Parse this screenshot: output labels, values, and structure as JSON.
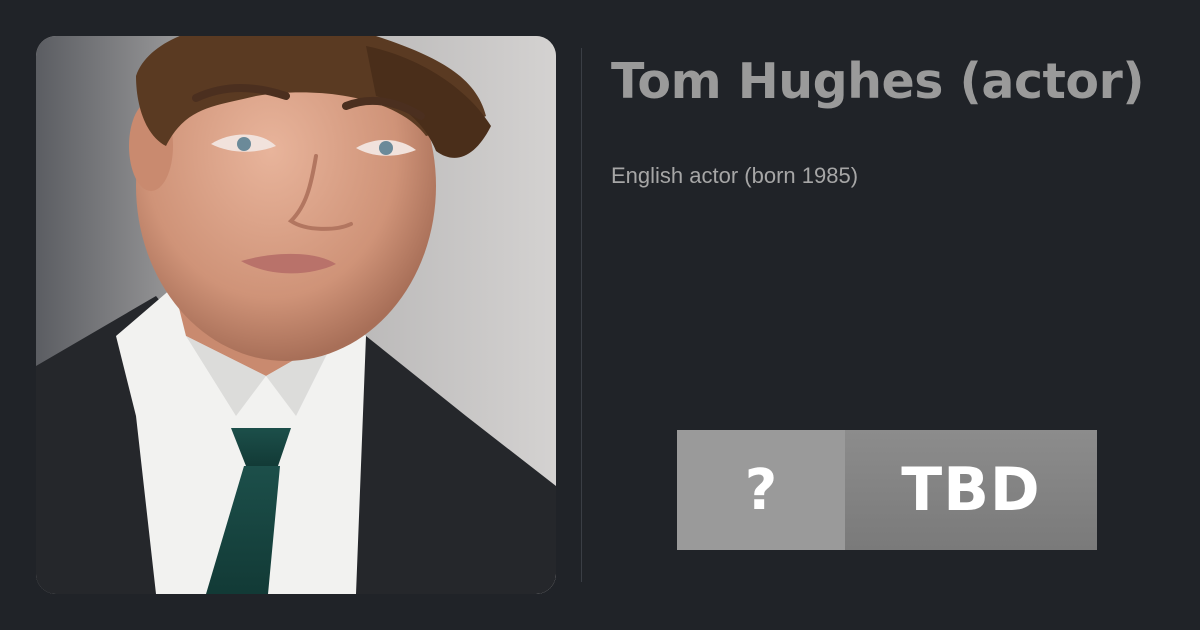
{
  "profile": {
    "name": "Tom Hughes (actor)",
    "description": "English actor (born 1985)",
    "photo_subject": "portrait-photo"
  },
  "rating": {
    "score": "?",
    "status": "TBD"
  },
  "colors": {
    "background": "#202328",
    "title": "#9a9a9a",
    "description": "#a6a6a6",
    "score_box": "#9a9a9a",
    "status_box": "#848484"
  }
}
